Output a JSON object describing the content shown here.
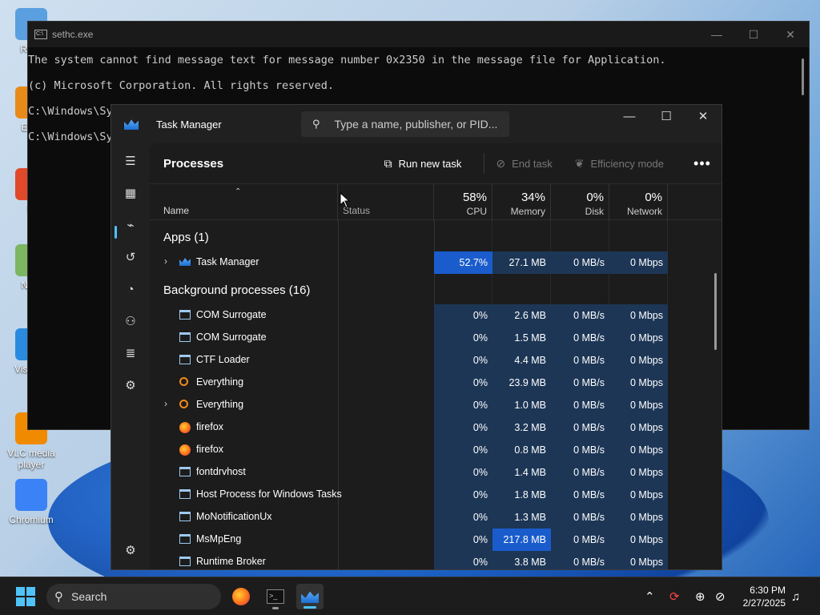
{
  "desktop": {
    "icons": [
      {
        "label": "Recy",
        "color": "#5aa0e0"
      },
      {
        "label": "Ever",
        "color": "#e88a1a"
      },
      {
        "label": "Fi",
        "color": "#e04a2a"
      },
      {
        "label": "Note",
        "color": "#7bb661"
      },
      {
        "label": "Visua C",
        "color": "#2a8ae0"
      },
      {
        "label": "VLC media player",
        "color": "#f08a00"
      },
      {
        "label": "Chromium",
        "color": "#3b82f6"
      }
    ]
  },
  "cmd": {
    "title": "sethc.exe",
    "lines": [
      "The system cannot find message text for message number 0x2350 in the message file for Application.",
      "(c) Microsoft Corporation. All rights reserved.",
      "C:\\Windows\\System32>explorer",
      "C:\\Windows\\Sy"
    ]
  },
  "taskmanager": {
    "title": "Task Manager",
    "search_placeholder": "Type a name, publisher, or PID...",
    "page_title": "Processes",
    "toolbar": {
      "run_new_task": "Run new task",
      "end_task": "End task",
      "efficiency_mode": "Efficiency mode",
      "more": "•••"
    },
    "columns": {
      "name": "Name",
      "status": "Status",
      "cpu": {
        "pct": "58%",
        "label": "CPU"
      },
      "memory": {
        "pct": "34%",
        "label": "Memory"
      },
      "disk": {
        "pct": "0%",
        "label": "Disk"
      },
      "network": {
        "pct": "0%",
        "label": "Network"
      }
    },
    "apps_header": "Apps (1)",
    "apps": [
      {
        "name": "Task Manager",
        "cpu": "52.7%",
        "memory": "27.1 MB",
        "disk": "0 MB/s",
        "network": "0 Mbps",
        "expandable": true,
        "icon": "taskmanager"
      }
    ],
    "bg_header": "Background processes (16)",
    "background": [
      {
        "name": "COM Surrogate",
        "cpu": "0%",
        "memory": "2.6 MB",
        "disk": "0 MB/s",
        "network": "0 Mbps",
        "icon": "window"
      },
      {
        "name": "COM Surrogate",
        "cpu": "0%",
        "memory": "1.5 MB",
        "disk": "0 MB/s",
        "network": "0 Mbps",
        "icon": "window"
      },
      {
        "name": "CTF Loader",
        "cpu": "0%",
        "memory": "4.4 MB",
        "disk": "0 MB/s",
        "network": "0 Mbps",
        "icon": "window"
      },
      {
        "name": "Everything",
        "cpu": "0%",
        "memory": "23.9 MB",
        "disk": "0 MB/s",
        "network": "0 Mbps",
        "icon": "search"
      },
      {
        "name": "Everything",
        "cpu": "0%",
        "memory": "1.0 MB",
        "disk": "0 MB/s",
        "network": "0 Mbps",
        "icon": "search",
        "expandable": true
      },
      {
        "name": "firefox",
        "cpu": "0%",
        "memory": "3.2 MB",
        "disk": "0 MB/s",
        "network": "0 Mbps",
        "icon": "firefox"
      },
      {
        "name": "firefox",
        "cpu": "0%",
        "memory": "0.8 MB",
        "disk": "0 MB/s",
        "network": "0 Mbps",
        "icon": "firefox"
      },
      {
        "name": "fontdrvhost",
        "cpu": "0%",
        "memory": "1.4 MB",
        "disk": "0 MB/s",
        "network": "0 Mbps",
        "icon": "window"
      },
      {
        "name": "Host Process for Windows Tasks",
        "cpu": "0%",
        "memory": "1.8 MB",
        "disk": "0 MB/s",
        "network": "0 Mbps",
        "icon": "window"
      },
      {
        "name": "MoNotificationUx",
        "cpu": "0%",
        "memory": "1.3 MB",
        "disk": "0 MB/s",
        "network": "0 Mbps",
        "icon": "window"
      },
      {
        "name": "MsMpEng",
        "cpu": "0%",
        "memory": "217.8 MB",
        "disk": "0 MB/s",
        "network": "0 Mbps",
        "icon": "window",
        "mem_highlight": true
      },
      {
        "name": "Runtime Broker",
        "cpu": "0%",
        "memory": "3.8 MB",
        "disk": "0 MB/s",
        "network": "0 Mbps",
        "icon": "window"
      }
    ],
    "colors": {
      "heat_low": "#1d3656",
      "heat_high": "#1a5ccc",
      "accent": "#4cc2ff"
    }
  },
  "taskbar": {
    "search_label": "Search",
    "time": "6:30 PM",
    "date": "2/27/2025"
  }
}
